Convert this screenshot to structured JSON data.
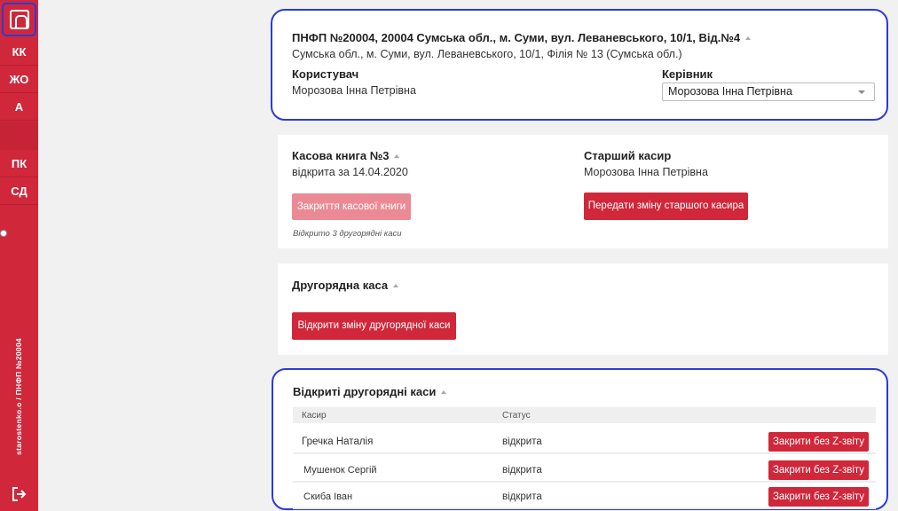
{
  "sidebar": {
    "items": [
      {
        "label": "КК"
      },
      {
        "label": "ЖО"
      },
      {
        "label": "А"
      },
      {
        "label": "ПК"
      },
      {
        "label": "СД"
      }
    ],
    "user_caption": "starostenko.o / ПНФП №20004",
    "accent_color": "#d0273b"
  },
  "branch": {
    "title": "ПНФП №20004, 20004 Сумська обл., м. Суми, вул. Леваневського, 10/1, Від.№4",
    "subtitle": "Сумська обл., м. Суми, вул. Леваневського, 10/1, Філія № 13 (Сумська обл.)",
    "user_label": "Користувач",
    "user_value": "Морозова Інна Петрівна",
    "manager_label": "Керівник",
    "manager_selected": "Морозова Інна Петрівна"
  },
  "cashbook": {
    "title": "Касова книга №3",
    "opened_text": "відкрита за 14.04.2020",
    "close_button": "Закриття касової книги",
    "note": "Відкрито 3 другорядні каси",
    "senior_label": "Старший касир",
    "senior_value": "Морозова Інна Петрівна",
    "transfer_button": "Передати зміну старшого касира"
  },
  "secondary": {
    "title": "Другорядна каса",
    "open_button": "Відкрити зміну другорядної каси"
  },
  "open_secondary": {
    "title": "Відкриті другорядні каси",
    "columns": [
      "Касир",
      "Статус"
    ],
    "rows": [
      {
        "cashier": "Гречка Наталія",
        "status": "відкрита",
        "action": "Закрити без Z-звіту"
      },
      {
        "cashier": "Мушенок Сергій",
        "status": "відкрита",
        "action": "Закрити без Z-звіту"
      },
      {
        "cashier": "Скиба Іван",
        "status": "відкрита",
        "action": "Закрити без Z-звіту"
      }
    ]
  }
}
